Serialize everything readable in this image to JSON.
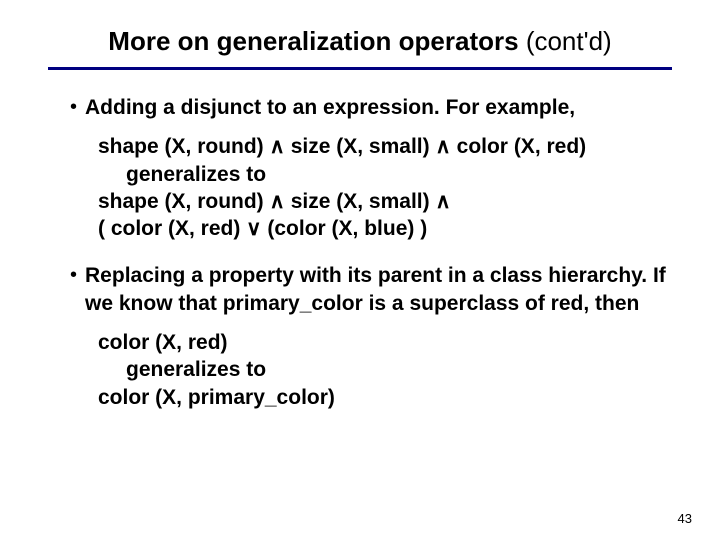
{
  "title": {
    "main": "More on generalization operators ",
    "suffix": "(cont'd)"
  },
  "bullets": [
    "Adding a disjunct to an expression. For example,",
    "Replacing a property with its parent in a class hierarchy. If we know that primary_color is a superclass of red, then"
  ],
  "example1": {
    "line1": "shape (X, round) ∧ size (X, small) ∧ color (X, red)",
    "gen": "generalizes to",
    "line2a": "shape (X, round) ∧ size (X, small) ∧",
    "line2b": "( color (X, red) ∨ (color (X, blue) )"
  },
  "example2": {
    "line1": "color (X, red)",
    "gen": "generalizes to",
    "line2": "color (X, primary_color)"
  },
  "page_number": "43"
}
